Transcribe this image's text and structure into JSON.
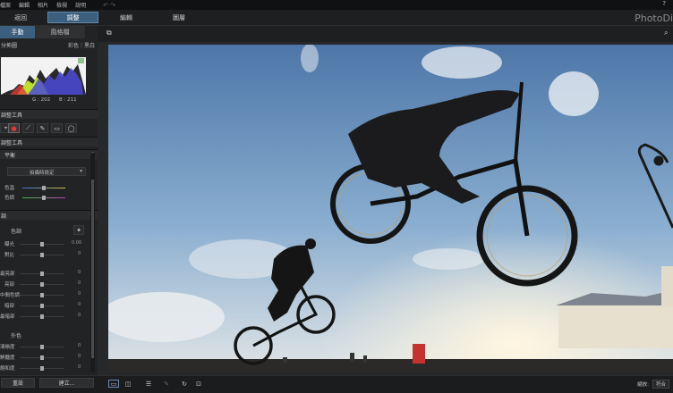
{
  "menu": {
    "items": [
      "檔案",
      "編輯",
      "相片",
      "檢視",
      "說明"
    ],
    "undo": "↶  ↷",
    "help": "?"
  },
  "modes": {
    "back": "返回",
    "adjust": "調整",
    "edit": "編輯",
    "layers": "圖層"
  },
  "brand": "PhotoDi",
  "left_tabs": {
    "manual": "手動",
    "presets": "風格檔"
  },
  "histogram": {
    "label": "分佈圖",
    "mode": "彩色｜黑白",
    "g_label": "G : 202",
    "b_label": "B : 211"
  },
  "tools_header": "調整工具",
  "panel_header": "調整工具",
  "wb": {
    "title": "平衡",
    "preset": "拍攝時設定",
    "temp_label": "色溫",
    "tint_label": "色調"
  },
  "tone": {
    "title": "調",
    "subtitle": "色調",
    "exposure_label": "曝光",
    "exposure_value": "0.00",
    "contrast_label": "對比",
    "contrast_value": "0",
    "highlights_label": "最亮部",
    "highlights_value": "0",
    "bright_label": "亮部",
    "bright_value": "0",
    "midtone_label": "中間色調",
    "midtone_value": "0",
    "shadows_label": "暗部",
    "shadows_value": "0",
    "blacks_label": "最暗部",
    "blacks_value": "0",
    "presence": "外色",
    "clarity_label": "清晰度",
    "clarity_value": "0",
    "vibrance_label": "鮮豔度",
    "vibrance_value": "0",
    "saturation_label": "飽和度",
    "saturation_value": "0"
  },
  "bottom": {
    "reset": "重設",
    "create": "建立...",
    "zoom_label": "縮放:",
    "zoom_value": "符合"
  },
  "colors": {
    "accent": "#3b5f7d",
    "panel": "#222325"
  }
}
